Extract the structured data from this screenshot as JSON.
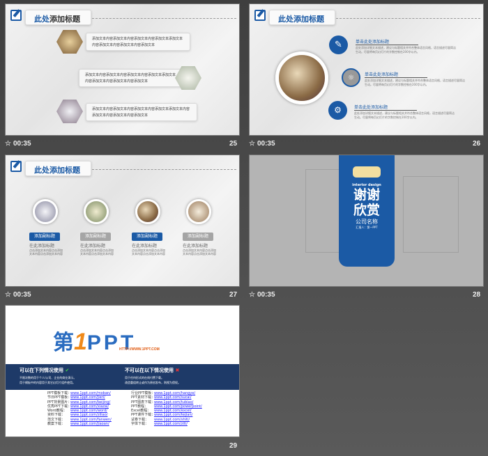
{
  "slides": [
    {
      "number": "25",
      "time": "00:35",
      "title_blue": "此处",
      "title_rest": "添加标题",
      "items": [
        "添加文本内容添加文本内容添加文本内容添加文本添加文本内容添加文本内容添加文本内容添加文本",
        "添加文本内容添加文本内容添加文本内容添加文本添加文本内容添加文本内容添加文本内容添加文本",
        "添加文本内容添加文本内容添加文本内容添加文本添加文本内容添加文本内容添加文本内容添加文本"
      ]
    },
    {
      "number": "26",
      "time": "00:35",
      "title": "此处添加标题",
      "items": [
        {
          "title": "单击此处添加标题",
          "desc": "此处添加详细文本描述，建议与标题相关并符合整体语言风格，语言描述尽量简洁生动。尽量将每页幻灯片的字数控制在200字以内。",
          "icon": "edit-icon"
        },
        {
          "title": "单击此处添加标题",
          "desc": "此处添加详细文本描述，建议与标题相关并符合整体语言风格，语言描述尽量简洁生动。尽量将每页幻灯片的字数控制在200字以内。",
          "icon": "hand-idea-icon"
        },
        {
          "title": "单击此处添加标题",
          "desc": "此处添加详细文本描述，建议与标题相关并符合整体语言风格，语言描述尽量简洁生动。尽量将每页幻灯片的字数控制在200字以内。",
          "icon": "person-gears-icon"
        }
      ]
    },
    {
      "number": "27",
      "time": "00:35",
      "title": "此处添加标题",
      "items": [
        {
          "label": "添加副标题",
          "heading": "在此添加标题",
          "desc": "点击添加文本内容点击添加文本内容点击添加文本内容"
        },
        {
          "label": "添加副标题",
          "heading": "在此添加标题",
          "desc": "点击添加文本内容点击添加文本内容点击添加文本内容"
        },
        {
          "label": "添加副标题",
          "heading": "在此添加标题",
          "desc": "点击添加文本内容点击添加文本内容点击添加文本内容"
        },
        {
          "label": "添加副标题",
          "heading": "在此添加标题",
          "desc": "点击添加文本内容点击添加文本内容点击添加文本内容"
        }
      ]
    },
    {
      "number": "28",
      "time": "00:35",
      "subtitle": "interior design",
      "thanks1": "谢谢",
      "thanks2": "欣赏",
      "company": "公司名称",
      "reporter": "汇报人：第一PPT"
    },
    {
      "number": "29",
      "logo_cn": "第",
      "logo_num": "1",
      "logo_en": "PPT",
      "logo_url": "HTTP://WWW.1PPT.COM",
      "can_title": "可以在下列情况使用",
      "can_items": [
        "不限次数的用于个人/公司、企业的商业演示。",
        "用于模板中的内容用于其它幻灯片组件使用。"
      ],
      "cannot_title": "不可以在以下情况使用",
      "cannot_items": [
        "用于任何形式的在线付费下载。",
        "改造重组转让或作为原创发布，则视为侵权。"
      ],
      "links_left": [
        [
          "PPT模板下载：",
          "www.1ppt.com/moban/"
        ],
        [
          "节日PPT模板：",
          "www.1ppt.com/jieri/"
        ],
        [
          "PPT背景图片：",
          "www.1ppt.com/beijing/"
        ],
        [
          "优秀PPT下载：",
          "www.1ppt.com/xiazai/"
        ],
        [
          "Word教程：",
          "www.1ppt.com/word/"
        ],
        [
          "资料下载：",
          "www.1ppt.com/ziliao/"
        ],
        [
          "范文下载：",
          "www.1ppt.com/fanwen/"
        ],
        [
          "教案下载：",
          "www.1ppt.com/jiaoan/"
        ]
      ],
      "links_right": [
        [
          "行业PPT模板：",
          "www.1ppt.com/hangye/"
        ],
        [
          "PPT素材下载：",
          "www.1ppt.com/sucai/"
        ],
        [
          "PPT图表下载：",
          "www.1ppt.com/tubiao/"
        ],
        [
          "PPT教程：",
          "www.1ppt.com/powerpoint/"
        ],
        [
          "Excel教程：",
          "www.1ppt.com/excel/"
        ],
        [
          "PPT课件下载：",
          "www.1ppt.com/kejian/"
        ],
        [
          "试卷下载：",
          "www.1ppt.com/shiti/"
        ],
        [
          "字体下载：",
          "www.1ppt.com/ziti/"
        ]
      ]
    }
  ]
}
